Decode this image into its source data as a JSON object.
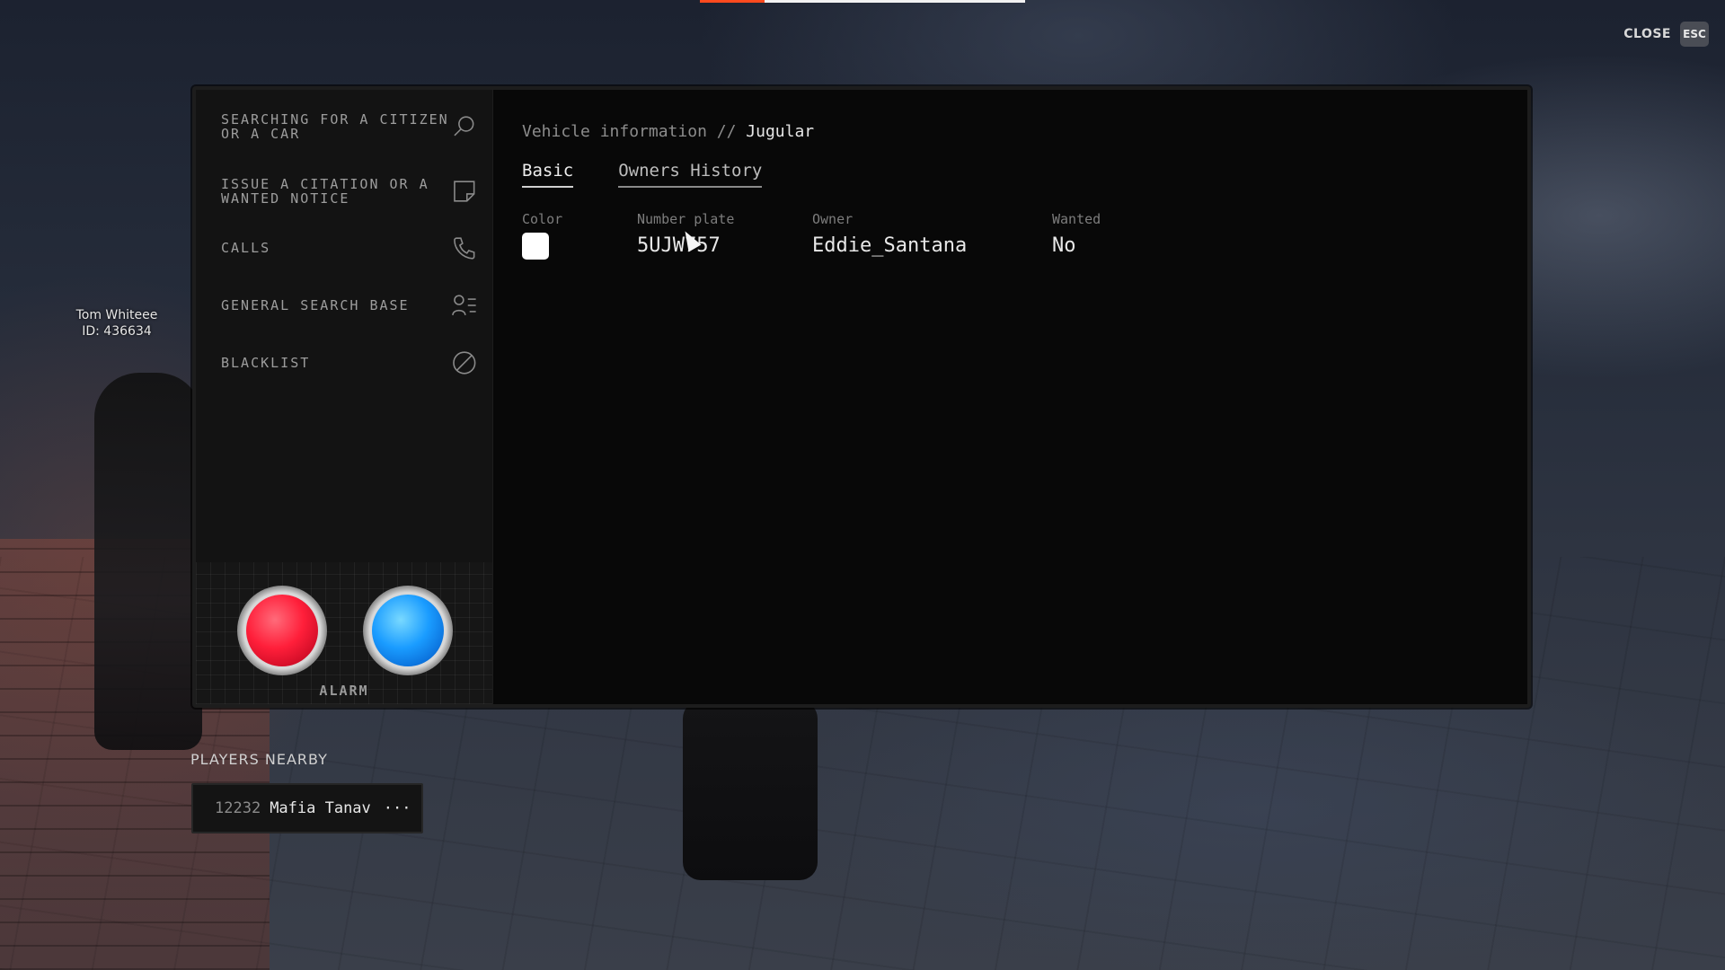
{
  "hud": {
    "progress_pct": 20,
    "progress_color": "#ff4a1e",
    "close_label": "CLOSE",
    "esc_key": "ESC"
  },
  "world": {
    "player_tag_name": "Tom Whiteee",
    "player_tag_id": "ID: 436634"
  },
  "sidebar": {
    "items": [
      {
        "label": "SEARCHING FOR A CITIZEN OR A CAR",
        "icon": "search-icon"
      },
      {
        "label": "ISSUE A CITATION OR A WANTED NOTICE",
        "icon": "note-icon"
      },
      {
        "label": "CALLS",
        "icon": "phone-icon"
      },
      {
        "label": "GENERAL SEARCH BASE",
        "icon": "user-list-icon"
      },
      {
        "label": "BLACKLIST",
        "icon": "ban-icon"
      }
    ],
    "alarm": {
      "label": "ALARM",
      "red_color": "#ff1f3a",
      "blue_color": "#1a9cff"
    }
  },
  "main": {
    "breadcrumb_prefix": "Vehicle information //",
    "breadcrumb_current": "Jugular",
    "tabs": [
      {
        "label": "Basic",
        "active": true
      },
      {
        "label": "Owners History",
        "active": false
      }
    ],
    "vehicle": {
      "color_label": "Color",
      "color_value": "#ffffff",
      "plate_label": "Number plate",
      "plate_value": "5UJW757",
      "owner_label": "Owner",
      "owner_value": "Eddie_Santana",
      "wanted_label": "Wanted",
      "wanted_value": "No"
    }
  },
  "nearby": {
    "title": "PLAYERS NEARBY",
    "players": [
      {
        "id": "12232",
        "name": "Mafia Tanav",
        "more": "···"
      }
    ]
  }
}
